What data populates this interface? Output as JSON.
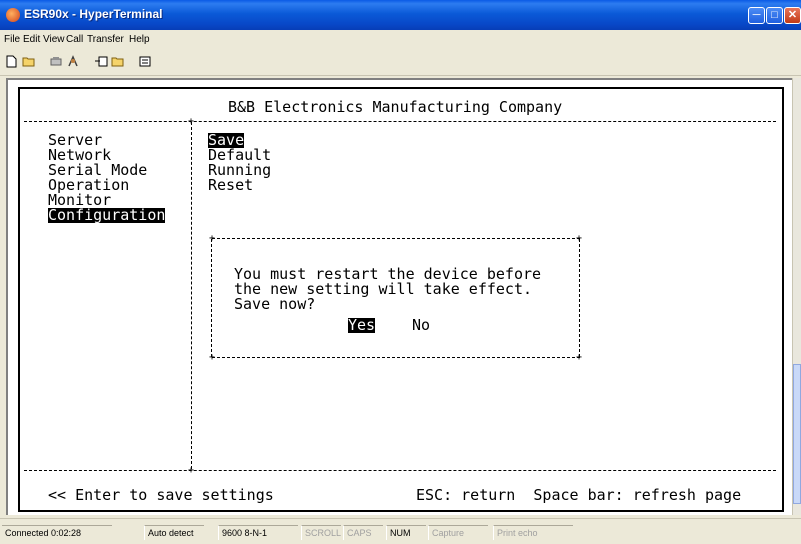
{
  "window": {
    "title": "ESR90x - HyperTerminal"
  },
  "menu": [
    "File",
    "Edit",
    "View",
    "Call",
    "Transfer",
    "Help"
  ],
  "toolbar_icons": [
    "new-icon",
    "open-icon",
    "connect-icon",
    "disconnect-icon",
    "send-icon",
    "receive-icon",
    "properties-icon"
  ],
  "terminal": {
    "header": "B&B Electronics Manufacturing Company",
    "left_menu": [
      "Server",
      "Network",
      "Serial Mode",
      "Operation",
      "Monitor",
      "Configuration"
    ],
    "selected_left": "Configuration",
    "right_menu": [
      "Save",
      "Default",
      "Running",
      "Reset"
    ],
    "selected_right": "Save",
    "dialog": {
      "lines": [
        "You must restart the device before",
        "the new setting will take effect.",
        "Save now?"
      ],
      "yes": "Yes",
      "no": "No"
    },
    "footer_left": "<< Enter to save settings",
    "footer_right": "ESC: return  Space bar: refresh page"
  },
  "status": {
    "connected": "Connected 0:02:28",
    "detect": "Auto detect",
    "port": "9600 8-N-1",
    "scroll": "SCROLL",
    "caps": "CAPS",
    "num": "NUM",
    "capture": "Capture",
    "printecho": "Print echo"
  }
}
